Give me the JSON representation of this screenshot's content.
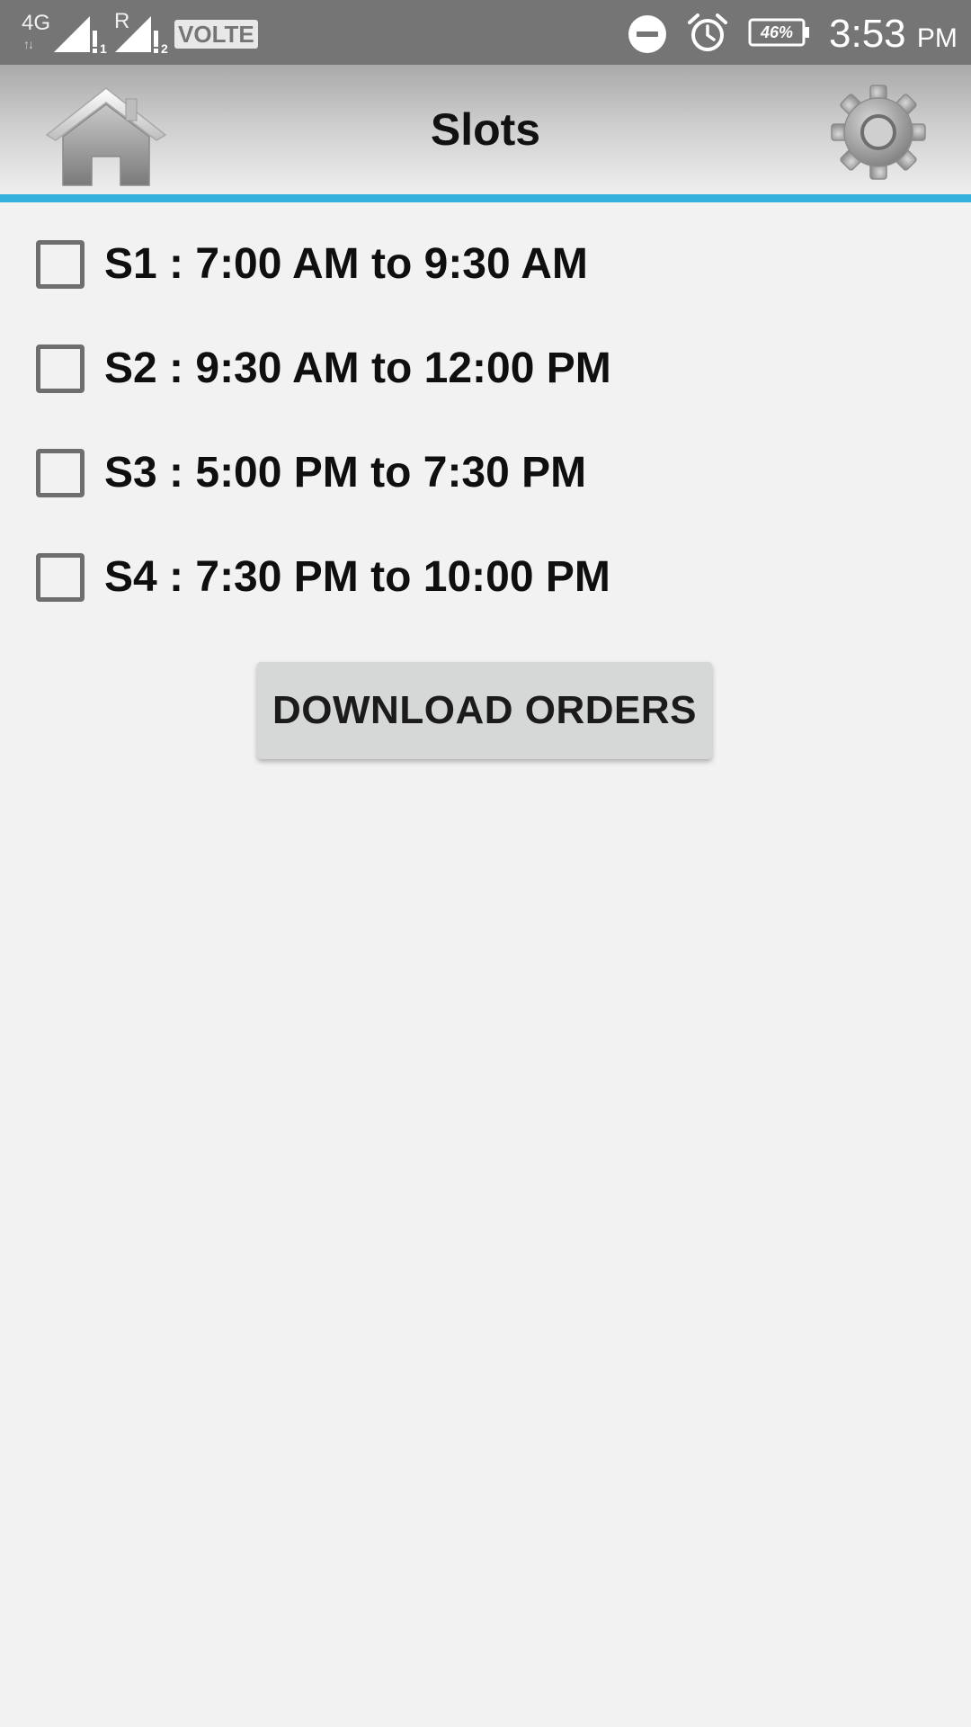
{
  "status_bar": {
    "network_type": "4G",
    "roaming_indicator": "R",
    "sim1_slot": "1",
    "sim2_slot": "2",
    "volte_label": "VOLTE",
    "battery_percent": "46%",
    "time": "3:53",
    "time_period": "PM",
    "icons": [
      "network-activity-icon",
      "signal-sim1-icon",
      "signal-sim2-icon",
      "dnd-icon",
      "alarm-icon",
      "battery-icon"
    ]
  },
  "header": {
    "title": "Slots",
    "home_icon": "home-icon",
    "settings_icon": "gear-icon",
    "accent_color": "#35b1dd"
  },
  "slots": [
    {
      "label": "S1 : 7:00 AM to 9:30 AM",
      "checked": false
    },
    {
      "label": "S2 : 9:30 AM to 12:00 PM",
      "checked": false
    },
    {
      "label": "S3 : 5:00 PM to 7:30 PM",
      "checked": false
    },
    {
      "label": "S4 : 7:30 PM to 10:00 PM",
      "checked": false
    }
  ],
  "actions": {
    "download_label": "DOWNLOAD ORDERS"
  }
}
